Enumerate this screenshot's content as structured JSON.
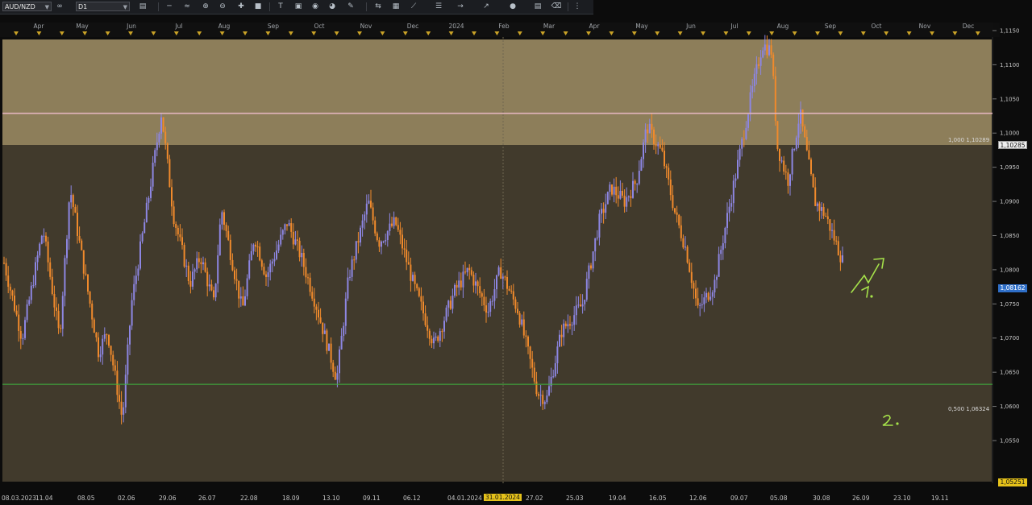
{
  "toolbar": {
    "symbol": "AUD/NZD",
    "timeframe": "D1",
    "colors": {
      "bg": "#1b1d21",
      "field": "#2a2c31"
    }
  },
  "top_axis": {
    "labels": [
      "Apr",
      "May",
      "Jun",
      "Jul",
      "Aug",
      "Sep",
      "Oct",
      "Nov",
      "Dec",
      "2024",
      "Feb",
      "Mar",
      "Apr",
      "May",
      "Jun",
      "Jul",
      "Aug",
      "Sep",
      "Oct",
      "Nov",
      "Dec"
    ],
    "positions_x": [
      48,
      102,
      163,
      222,
      278,
      339,
      396,
      454,
      512,
      566,
      625,
      681,
      737,
      796,
      857,
      911,
      971,
      1030,
      1087,
      1147,
      1201
    ]
  },
  "bottom_axis": {
    "labels": [
      "08.03.2023",
      "11.04",
      "08.05",
      "02.06",
      "29.06",
      "26.07",
      "22.08",
      "18.09",
      "13.10",
      "09.11",
      "06.12",
      "04.01.2024",
      "31.01.2024",
      "27.02",
      "25.03",
      "19.04",
      "16.05",
      "12.06",
      "09.07",
      "05.08",
      "30.08",
      "26.09",
      "23.10",
      "19.11"
    ],
    "highlight": "31.01.2024"
  },
  "price_axis": {
    "labels": [
      "1,1150",
      "1,1100",
      "1,1050",
      "1,1000",
      "1,0950",
      "1,0900",
      "1,0850",
      "1,0800",
      "1,0750",
      "1,0700",
      "1,0650",
      "1,0600",
      "1,0550"
    ],
    "values": [
      1.115,
      1.11,
      1.105,
      1.1,
      1.095,
      1.09,
      1.085,
      1.08,
      1.075,
      1.07,
      1.065,
      1.06,
      1.055
    ],
    "current_price": "1,08162",
    "level_tag": "1,10285",
    "min_tag": "1,05251"
  },
  "fib_levels": [
    {
      "label": "1,000 1,10289",
      "value": 1.10289,
      "color": "#e2b4bd"
    },
    {
      "label": "0,500 1,06324",
      "value": 1.06324,
      "color": "#3fb33f"
    }
  ],
  "annotations": {
    "mark1": "1.",
    "mark2": "2."
  },
  "colors": {
    "bull": "#8d86e2",
    "bear": "#f08a2c",
    "zone_upper": "#8d7e5a",
    "zone_lower": "#413a2c",
    "annotation": "#a6e24a",
    "triangle": "#c9a227"
  },
  "chart_data": {
    "type": "candlestick",
    "symbol": "AUD/NZD",
    "timeframe": "D1",
    "y_range": [
      1.0525,
      1.118
    ],
    "key_path": [
      [
        "2023-03-08",
        1.081
      ],
      [
        "2023-03-20",
        1.07
      ],
      [
        "2023-04-03",
        1.086
      ],
      [
        "2023-04-14",
        1.07
      ],
      [
        "2023-04-21",
        1.092
      ],
      [
        "2023-05-02",
        1.078
      ],
      [
        "2023-05-10",
        1.068
      ],
      [
        "2023-05-16",
        1.071
      ],
      [
        "2023-05-26",
        1.058
      ],
      [
        "2023-06-01",
        1.075
      ],
      [
        "2023-06-12",
        1.09
      ],
      [
        "2023-06-21",
        1.103
      ],
      [
        "2023-06-29",
        1.088
      ],
      [
        "2023-07-10",
        1.078
      ],
      [
        "2023-07-17",
        1.082
      ],
      [
        "2023-07-26",
        1.075
      ],
      [
        "2023-07-31",
        1.089
      ],
      [
        "2023-08-14",
        1.074
      ],
      [
        "2023-08-22",
        1.085
      ],
      [
        "2023-08-30",
        1.079
      ],
      [
        "2023-09-13",
        1.087
      ],
      [
        "2023-09-22",
        1.082
      ],
      [
        "2023-10-02",
        1.075
      ],
      [
        "2023-10-16",
        1.064
      ],
      [
        "2023-10-24",
        1.079
      ],
      [
        "2023-11-06",
        1.09
      ],
      [
        "2023-11-13",
        1.084
      ],
      [
        "2023-11-24",
        1.087
      ],
      [
        "2023-12-06",
        1.078
      ],
      [
        "2023-12-20",
        1.069
      ],
      [
        "2024-01-03",
        1.077
      ],
      [
        "2024-01-12",
        1.08
      ],
      [
        "2024-01-25",
        1.074
      ],
      [
        "2024-02-02",
        1.08
      ],
      [
        "2024-02-14",
        1.074
      ],
      [
        "2024-02-27",
        1.062
      ],
      [
        "2024-03-04",
        1.061
      ],
      [
        "2024-03-14",
        1.071
      ],
      [
        "2024-03-28",
        1.075
      ],
      [
        "2024-04-08",
        1.087
      ],
      [
        "2024-04-16",
        1.092
      ],
      [
        "2024-04-25",
        1.09
      ],
      [
        "2024-05-03",
        1.093
      ],
      [
        "2024-05-10",
        1.101
      ],
      [
        "2024-05-20",
        1.097
      ],
      [
        "2024-05-29",
        1.088
      ],
      [
        "2024-06-05",
        1.083
      ],
      [
        "2024-06-13",
        1.074
      ],
      [
        "2024-06-24",
        1.078
      ],
      [
        "2024-07-01",
        1.086
      ],
      [
        "2024-07-10",
        1.096
      ],
      [
        "2024-07-18",
        1.105
      ],
      [
        "2024-07-26",
        1.113
      ],
      [
        "2024-08-01",
        1.112
      ],
      [
        "2024-08-05",
        1.098
      ],
      [
        "2024-08-12",
        1.093
      ],
      [
        "2024-08-20",
        1.103
      ],
      [
        "2024-08-30",
        1.09
      ],
      [
        "2024-09-06",
        1.088
      ],
      [
        "2024-09-18",
        1.081
      ]
    ]
  }
}
